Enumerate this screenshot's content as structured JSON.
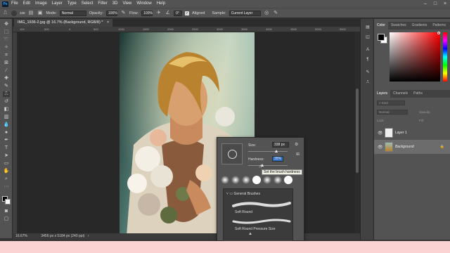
{
  "app": {
    "logo": "Ps",
    "menu": [
      "File",
      "Edit",
      "Image",
      "Layer",
      "Type",
      "Select",
      "Filter",
      "3D",
      "View",
      "Window",
      "Help"
    ]
  },
  "options": {
    "brush_size": "338",
    "mode_label": "Mode:",
    "mode_value": "Normal",
    "opacity_label": "Opacity:",
    "opacity_value": "100%",
    "flow_label": "Flow:",
    "flow_value": "100%",
    "angle_value": "0°",
    "aligned_label": "Aligned",
    "sample_label": "Sample:",
    "sample_value": "Current Layer"
  },
  "document": {
    "tab_title": "IMG_1936-2.jpg @ 16.7% (Background, RGB/8) *",
    "zoom": "16.67%",
    "dims": "3456 px x 5184 px (240 ppi)",
    "ruler_ticks": [
      "100",
      "500",
      "0",
      "500",
      "1000",
      "1500",
      "2000",
      "2500",
      "3000",
      "3500",
      "4000",
      "4500",
      "5000",
      "5500",
      "6000"
    ]
  },
  "panels": {
    "color_tabs": [
      "Color",
      "Swatches",
      "Gradients",
      "Patterns"
    ],
    "layer_tabs": [
      "Layers",
      "Channels",
      "Paths"
    ],
    "kind_label": "Kind",
    "blend_value": "Normal",
    "opacity_label": "Opacity:",
    "lock_label": "Lock:",
    "fill_label": "Fill:",
    "layers": [
      {
        "name": "Layer 1",
        "selected": false
      },
      {
        "name": "Background",
        "selected": true
      }
    ]
  },
  "brush_popup": {
    "size_label": "Size:",
    "size_value": "338 px",
    "size_level": 0.72,
    "hardness_label": "Hardness:",
    "hardness_value": "35%",
    "hardness_level": 0.35,
    "tooltip": "Set the brush hardness",
    "folder": "General Brushes",
    "brushes": [
      "Soft Round",
      "Soft Round Pressure Size"
    ]
  },
  "colors": {
    "accent": "#31a8ff",
    "foreground": "#000000",
    "background": "#ffffff"
  }
}
